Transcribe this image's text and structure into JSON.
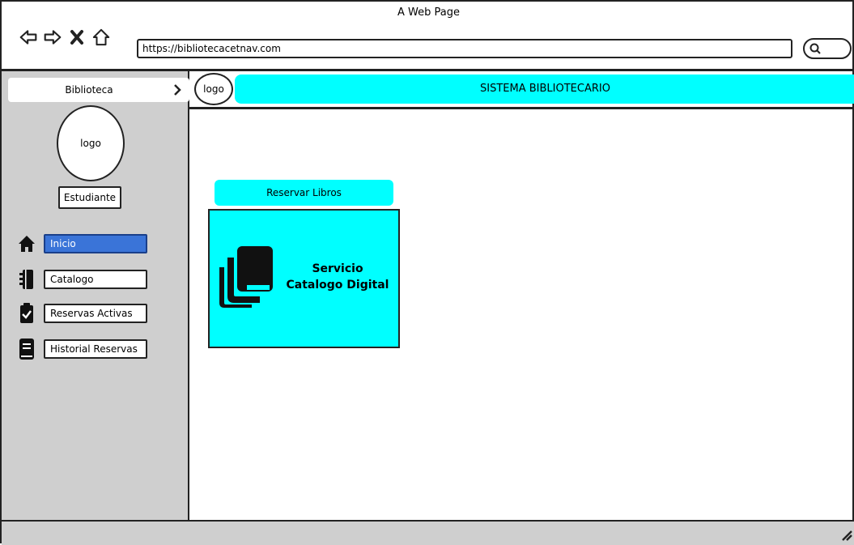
{
  "window": {
    "title": "A Web Page",
    "url": "https://bibliotecacetnav.com"
  },
  "sidebar": {
    "header": "Biblioteca",
    "logo": "logo",
    "role": "Estudiante",
    "items": [
      {
        "label": "Inicio",
        "icon": "home-icon",
        "active": true
      },
      {
        "label": "Catalogo",
        "icon": "notebook-icon",
        "active": false
      },
      {
        "label": "Reservas Activas",
        "icon": "clipboard-check-icon",
        "active": false
      },
      {
        "label": "Historial Reservas",
        "icon": "book-icon",
        "active": false
      }
    ]
  },
  "main": {
    "logo": "logo",
    "system_title": "SISTEMA BIBLIOTECARIO",
    "card": {
      "title": "Reservar Libros",
      "line1": "Servicio",
      "line2": "Catalogo Digital",
      "icon": "books-icon"
    }
  },
  "colors": {
    "accent": "#00ffff",
    "active_item": "#3a74d8",
    "sidebar_bg": "#cfcfcf"
  }
}
